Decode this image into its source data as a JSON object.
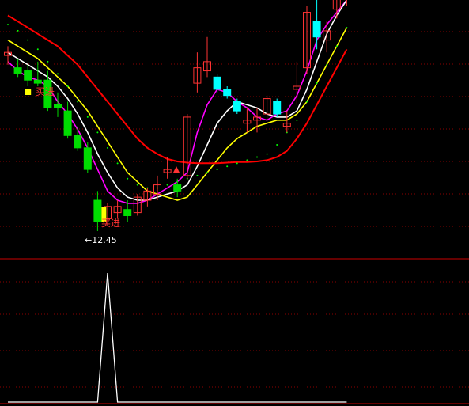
{
  "chart_data": [
    {
      "type": "candlestick",
      "panel": "price",
      "grid": true,
      "ylim": [
        12.0,
        16.2
      ],
      "candles": [
        {
          "o": 15.3,
          "h": 15.45,
          "l": 15.15,
          "c": 15.35
        },
        {
          "o": 15.1,
          "h": 15.25,
          "l": 14.95,
          "c": 15.0
        },
        {
          "o": 15.05,
          "h": 15.15,
          "l": 14.8,
          "c": 14.9
        },
        {
          "o": 14.9,
          "h": 15.2,
          "l": 14.8,
          "c": 14.85
        },
        {
          "o": 14.9,
          "h": 15.05,
          "l": 14.4,
          "c": 14.45
        },
        {
          "o": 14.5,
          "h": 14.7,
          "l": 14.3,
          "c": 14.45
        },
        {
          "o": 14.4,
          "h": 14.55,
          "l": 13.95,
          "c": 14.0
        },
        {
          "o": 14.0,
          "h": 14.15,
          "l": 13.75,
          "c": 13.8
        },
        {
          "o": 13.8,
          "h": 13.9,
          "l": 13.4,
          "c": 13.45
        },
        {
          "o": 12.95,
          "h": 13.1,
          "l": 12.45,
          "c": 12.6
        },
        {
          "o": 12.65,
          "h": 12.9,
          "l": 12.55,
          "c": 12.85
        },
        {
          "o": 12.75,
          "h": 12.95,
          "l": 12.65,
          "c": 12.85
        },
        {
          "o": 12.8,
          "h": 12.95,
          "l": 12.6,
          "c": 12.7
        },
        {
          "o": 12.75,
          "h": 13.05,
          "l": 12.7,
          "c": 13.0
        },
        {
          "o": 12.95,
          "h": 13.15,
          "l": 12.85,
          "c": 13.1
        },
        {
          "o": 13.05,
          "h": 13.35,
          "l": 12.95,
          "c": 13.2
        },
        {
          "o": 13.4,
          "h": 13.65,
          "l": 13.3,
          "c": 13.45
        },
        {
          "o": 13.2,
          "h": 13.3,
          "l": 13.0,
          "c": 13.1
        },
        {
          "o": 13.35,
          "h": 14.35,
          "l": 13.3,
          "c": 14.3
        },
        {
          "o": 14.85,
          "h": 15.35,
          "l": 14.7,
          "c": 15.1
        },
        {
          "o": 15.05,
          "h": 15.6,
          "l": 14.95,
          "c": 15.2
        },
        {
          "o": 14.95,
          "h": 15.0,
          "l": 14.7,
          "c": 14.75
        },
        {
          "o": 14.75,
          "h": 14.8,
          "l": 14.6,
          "c": 14.65
        },
        {
          "o": 14.55,
          "h": 14.6,
          "l": 14.35,
          "c": 14.4
        },
        {
          "o": 14.2,
          "h": 14.45,
          "l": 14.05,
          "c": 14.25
        },
        {
          "o": 14.25,
          "h": 14.45,
          "l": 14.05,
          "c": 14.3
        },
        {
          "o": 14.35,
          "h": 14.65,
          "l": 14.25,
          "c": 14.6
        },
        {
          "o": 14.55,
          "h": 14.6,
          "l": 14.3,
          "c": 14.35
        },
        {
          "o": 14.15,
          "h": 14.4,
          "l": 14.05,
          "c": 14.2
        },
        {
          "o": 14.75,
          "h": 15.2,
          "l": 14.5,
          "c": 14.8
        },
        {
          "o": 15.1,
          "h": 16.1,
          "l": 15.0,
          "c": 16.0
        },
        {
          "o": 15.85,
          "h": 16.2,
          "l": 15.4,
          "c": 15.6
        },
        {
          "o": 15.55,
          "h": 15.85,
          "l": 15.35,
          "c": 15.7
        },
        {
          "o": 16.05,
          "h": 16.35,
          "l": 15.9,
          "c": 16.3
        },
        {
          "o": 16.25,
          "h": 16.4,
          "l": 16.1,
          "c": 16.35
        }
      ],
      "series": [
        {
          "color": "#ff00ff",
          "style": "line",
          "values": [
            15.2,
            15.05,
            14.95,
            14.9,
            14.8,
            14.55,
            14.35,
            14.1,
            13.8,
            13.45,
            13.1,
            12.95,
            12.9,
            12.9,
            12.95,
            13.05,
            13.15,
            13.25,
            13.4,
            14.05,
            14.5,
            14.75,
            14.7,
            14.55,
            14.45,
            14.3,
            14.25,
            14.35,
            14.4,
            14.65,
            15.05,
            15.55,
            15.8,
            16.0,
            16.2
          ]
        },
        {
          "color": "#ffffff",
          "style": "line",
          "values": [
            15.35,
            15.25,
            15.15,
            15.05,
            14.95,
            14.8,
            14.6,
            14.35,
            14.05,
            13.7,
            13.4,
            13.15,
            13.0,
            12.95,
            12.95,
            13.0,
            13.05,
            13.1,
            13.2,
            13.5,
            13.85,
            14.2,
            14.4,
            14.55,
            14.5,
            14.45,
            14.35,
            14.3,
            14.3,
            14.4,
            14.75,
            15.2,
            15.65,
            15.95,
            16.2
          ]
        },
        {
          "color": "#ffff00",
          "style": "line",
          "values": [
            15.55,
            15.45,
            15.35,
            15.25,
            15.1,
            14.95,
            14.8,
            14.6,
            14.4,
            14.15,
            13.9,
            13.65,
            13.4,
            13.25,
            13.1,
            13.05,
            13.0,
            12.95,
            13.0,
            13.2,
            13.4,
            13.6,
            13.8,
            13.95,
            14.05,
            14.15,
            14.2,
            14.25,
            14.25,
            14.35,
            14.55,
            14.85,
            15.15,
            15.45,
            15.75
          ]
        },
        {
          "color": "#ff0000",
          "style": "line",
          "values": [
            15.95,
            15.85,
            15.75,
            15.65,
            15.55,
            15.45,
            15.3,
            15.15,
            14.95,
            14.75,
            14.55,
            14.35,
            14.15,
            13.95,
            13.8,
            13.7,
            13.62,
            13.58,
            13.56,
            13.55,
            13.55,
            13.55,
            13.56,
            13.57,
            13.57,
            13.58,
            13.6,
            13.65,
            13.75,
            13.95,
            14.2,
            14.5,
            14.8,
            15.1,
            15.4
          ]
        },
        {
          "color": "#00ff00",
          "style": "dots",
          "values": [
            15.8,
            15.7,
            15.55,
            15.4,
            15.2,
            15.0,
            14.8,
            14.55,
            14.3,
            14.05,
            13.8,
            13.55,
            13.3,
            13.2,
            13.15,
            13.15,
            13.2,
            13.25,
            13.3,
            13.35,
            13.4,
            13.45,
            13.5,
            13.55,
            13.6,
            13.65,
            13.7,
            13.85,
            14.05,
            14.25,
            14.55,
            14.85,
            15.15,
            15.45,
            15.75
          ]
        }
      ],
      "annotations": [
        {
          "text": "买进",
          "color": "#ff3333"
        },
        {
          "text": "买进",
          "color": "#ff3333"
        },
        {
          "text": "←12.45",
          "color": "#ffffff"
        }
      ]
    },
    {
      "type": "line",
      "panel": "indicator",
      "grid": true,
      "ylim": [
        0,
        1
      ],
      "series": [
        {
          "color": "#ffffff",
          "values": [
            0,
            0,
            0,
            0,
            0,
            0,
            0,
            0,
            0,
            0,
            1,
            0,
            0,
            0,
            0,
            0,
            0,
            0,
            0,
            0,
            0,
            0,
            0,
            0,
            0,
            0,
            0,
            0,
            0,
            0,
            0,
            0,
            0,
            0,
            0
          ]
        }
      ]
    }
  ],
  "colors": {
    "background": "#000000",
    "grid": "#8b0000",
    "divider": "#cc0000",
    "up": "#ff3333",
    "down": "#00ffff",
    "down_strong": "#00dd00"
  }
}
